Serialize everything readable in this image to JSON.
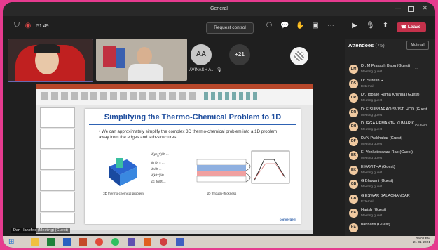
{
  "window": {
    "title": "General"
  },
  "toolbar": {
    "timer": "51:49",
    "request_control": "Request control",
    "leave": "Leave"
  },
  "participants": {
    "initials": "AA",
    "name": "AVINASH A...",
    "overflow": "+21"
  },
  "slide": {
    "title": "Simplifying the Thermo-Chemical Problem to 1D",
    "bullet": "We can approximately simplify the complex 3D thermo-chemical problem into a 1D problem away from the edges and sub-structures",
    "caption_left": "3D thermo-chemical problem",
    "caption_right": "1D through-thickness",
    "logo": "convergent"
  },
  "presenter_label": "Dan Hansfeld (Meeting) (Guest)",
  "attendees_panel": {
    "title": "Attendees",
    "count": "(75)",
    "mute_all": "Mute all",
    "items": [
      {
        "initials": "DM",
        "name": "Dr. M Prakash Babu (Guest)",
        "role": "Meeting guest",
        "color": "#f0c9a0",
        "extra": "..."
      },
      {
        "initials": "DS",
        "name": "Dr. Suresh R.",
        "role": "External",
        "color": "#f0c9a0",
        "extra": ""
      },
      {
        "initials": "DR",
        "name": "Dr. Topalle Rama Krishna (Guest)",
        "role": "Meeting guest",
        "color": "#f0c9a0",
        "extra": ""
      },
      {
        "initials": "DR",
        "name": "Dr.E.SUBBARAO SVIST, HOD (Guest)",
        "role": "Meeting guest",
        "color": "#f0c9a0",
        "extra": ""
      },
      {
        "initials": "DH",
        "name": "DURGA HEMANTH KUMAR K...",
        "role": "Meeting guest",
        "color": "#f0c9a0",
        "extra": "On hold"
      },
      {
        "initials": "DP",
        "name": "DVN Prabhakar (Guest)",
        "role": "Meeting guest",
        "color": "#f0c9a0",
        "extra": ""
      },
      {
        "initials": "ER",
        "name": "E. Venkateswara Rao (Guest)",
        "role": "Meeting guest",
        "color": "#f0c9a0",
        "extra": ""
      },
      {
        "initials": "EK",
        "name": "E.KAVITHA (Guest)",
        "role": "Meeting guest",
        "color": "#f0c9a0",
        "extra": ""
      },
      {
        "initials": "GB",
        "name": "G Bhavani (Guest)",
        "role": "Meeting guest",
        "color": "#f0c9a0",
        "extra": ""
      },
      {
        "initials": "GB",
        "name": "G ESWAR BALACHANDAR",
        "role": "External",
        "color": "#f0c9a0",
        "extra": ""
      },
      {
        "initials": "HA",
        "name": "Harish (Guest)",
        "role": "Meeting guest",
        "color": "#f0c9a0",
        "extra": ""
      },
      {
        "initials": "HA",
        "name": "hariharis (Guest)",
        "role": "",
        "color": "#f0c9a0",
        "extra": ""
      }
    ]
  },
  "taskbar": {
    "time": "09:02 PM",
    "date": "21-01-2021"
  },
  "colors": {
    "leave": "#c4314b",
    "accent": "#e63b8f",
    "slide_title": "#1f4e9e"
  }
}
